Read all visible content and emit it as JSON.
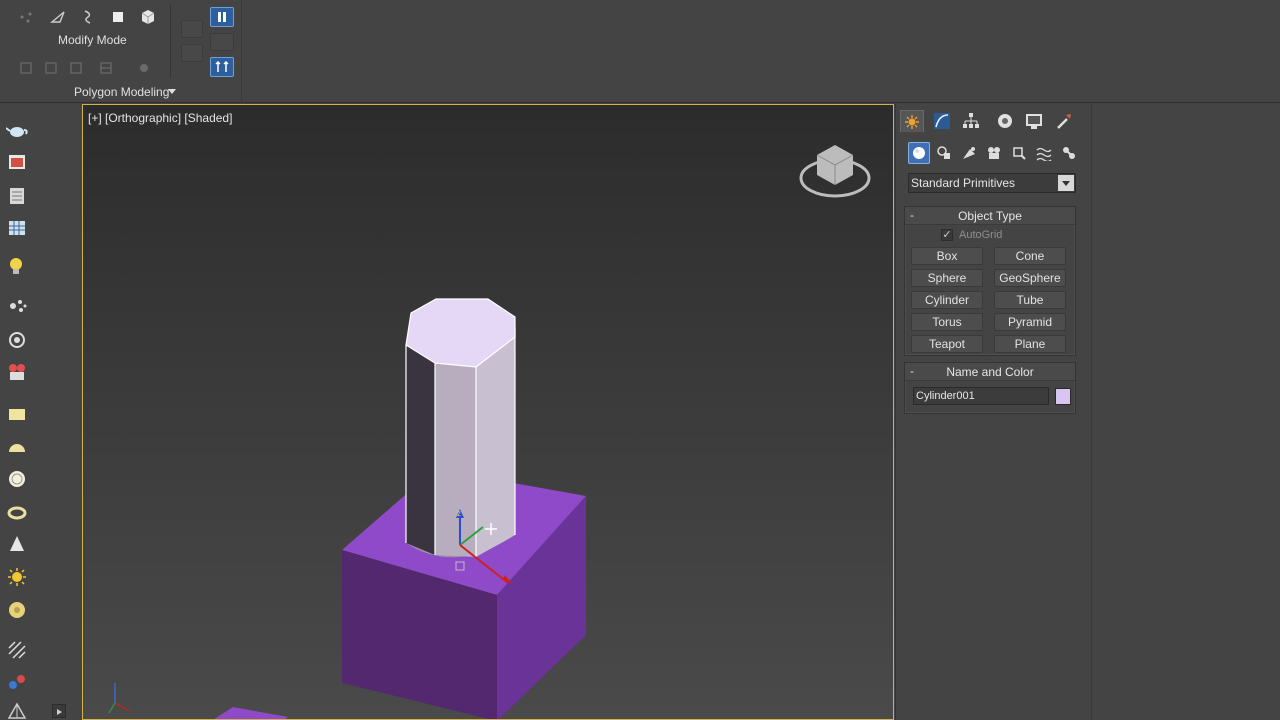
{
  "ribbon": {
    "mode_label": "Modify Mode",
    "modeling_label": "Polygon Modeling"
  },
  "viewport": {
    "label": "[+] [Orthographic] [Shaded]"
  },
  "command_panel": {
    "category": "Standard Primitives",
    "object_type": {
      "title": "Object Type",
      "minus": "-",
      "autogrid_label": "AutoGrid",
      "autogrid_mark": "✓",
      "buttons": [
        "Box",
        "Cone",
        "Sphere",
        "GeoSphere",
        "Cylinder",
        "Tube",
        "Torus",
        "Pyramid",
        "Teapot",
        "Plane"
      ]
    },
    "name_and_color": {
      "title": "Name and Color",
      "minus": "-",
      "object_name": "Cylinder001",
      "object_color": "#d9c6f0"
    }
  },
  "colors": {
    "box_purple": "#8e4ac8",
    "viewport_border": "#d2b24a",
    "active_blue": "#3f6fb5"
  }
}
